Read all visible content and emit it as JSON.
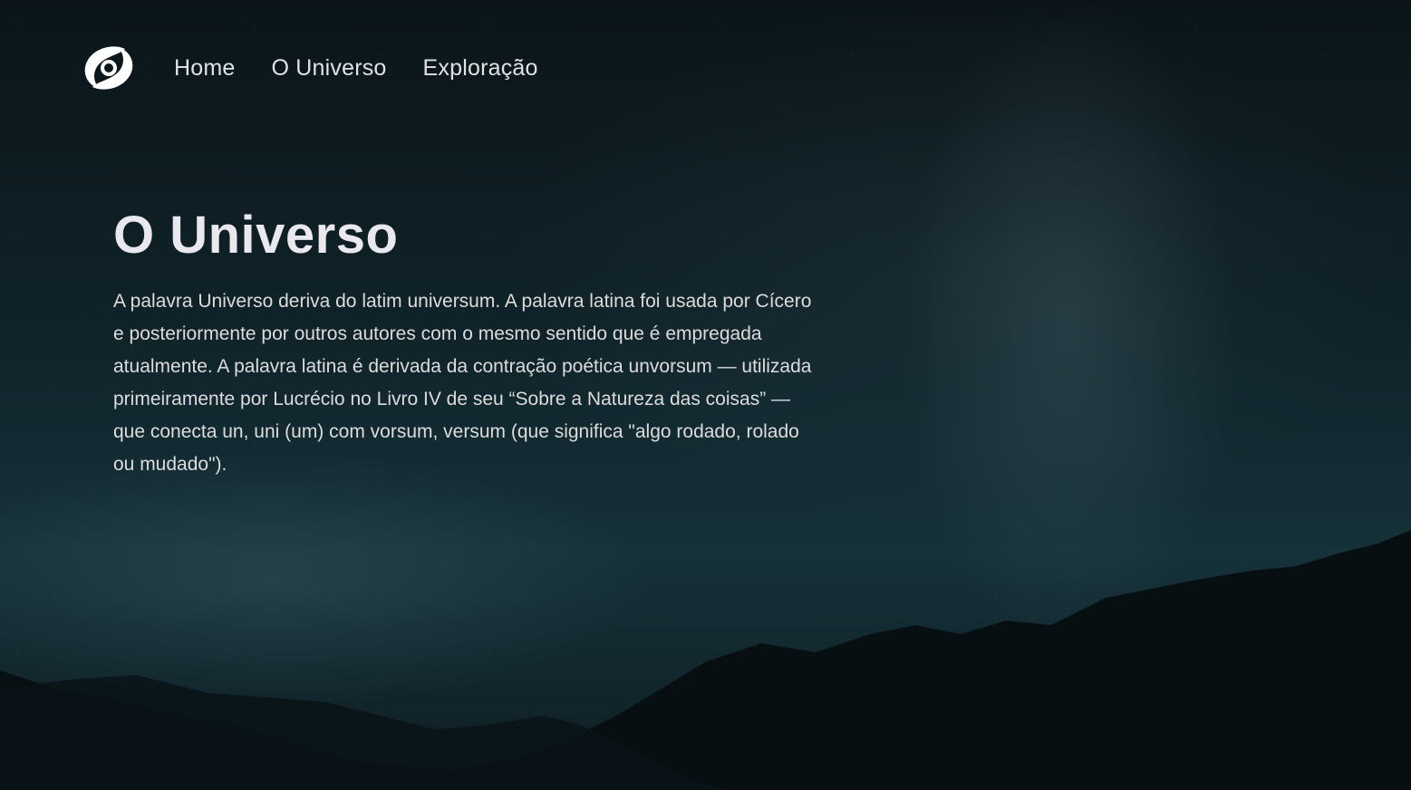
{
  "nav": {
    "logo_icon": "spiral-galaxy-logo-icon",
    "links": [
      "Home",
      "O Universo",
      "Exploração"
    ]
  },
  "hero": {
    "title": "O Universo",
    "text": "A palavra Universo deriva do latim universum. A palavra latina foi usada por Cícero e posteriormente por outros autores com o mesmo sentido que é empregada atualmente. A palavra latina é derivada da contração poética unvorsum — utilizada primeiramente por Lucrécio no Livro IV de seu “Sobre a Natureza das coisas” — que conecta un, uni (um) com vorsum, versum (que significa \"algo rodado, rolado ou mudado\")."
  },
  "colors": {
    "background": "#0c1a1f",
    "text": "#e6e6e6",
    "mountains": "#070d10"
  }
}
